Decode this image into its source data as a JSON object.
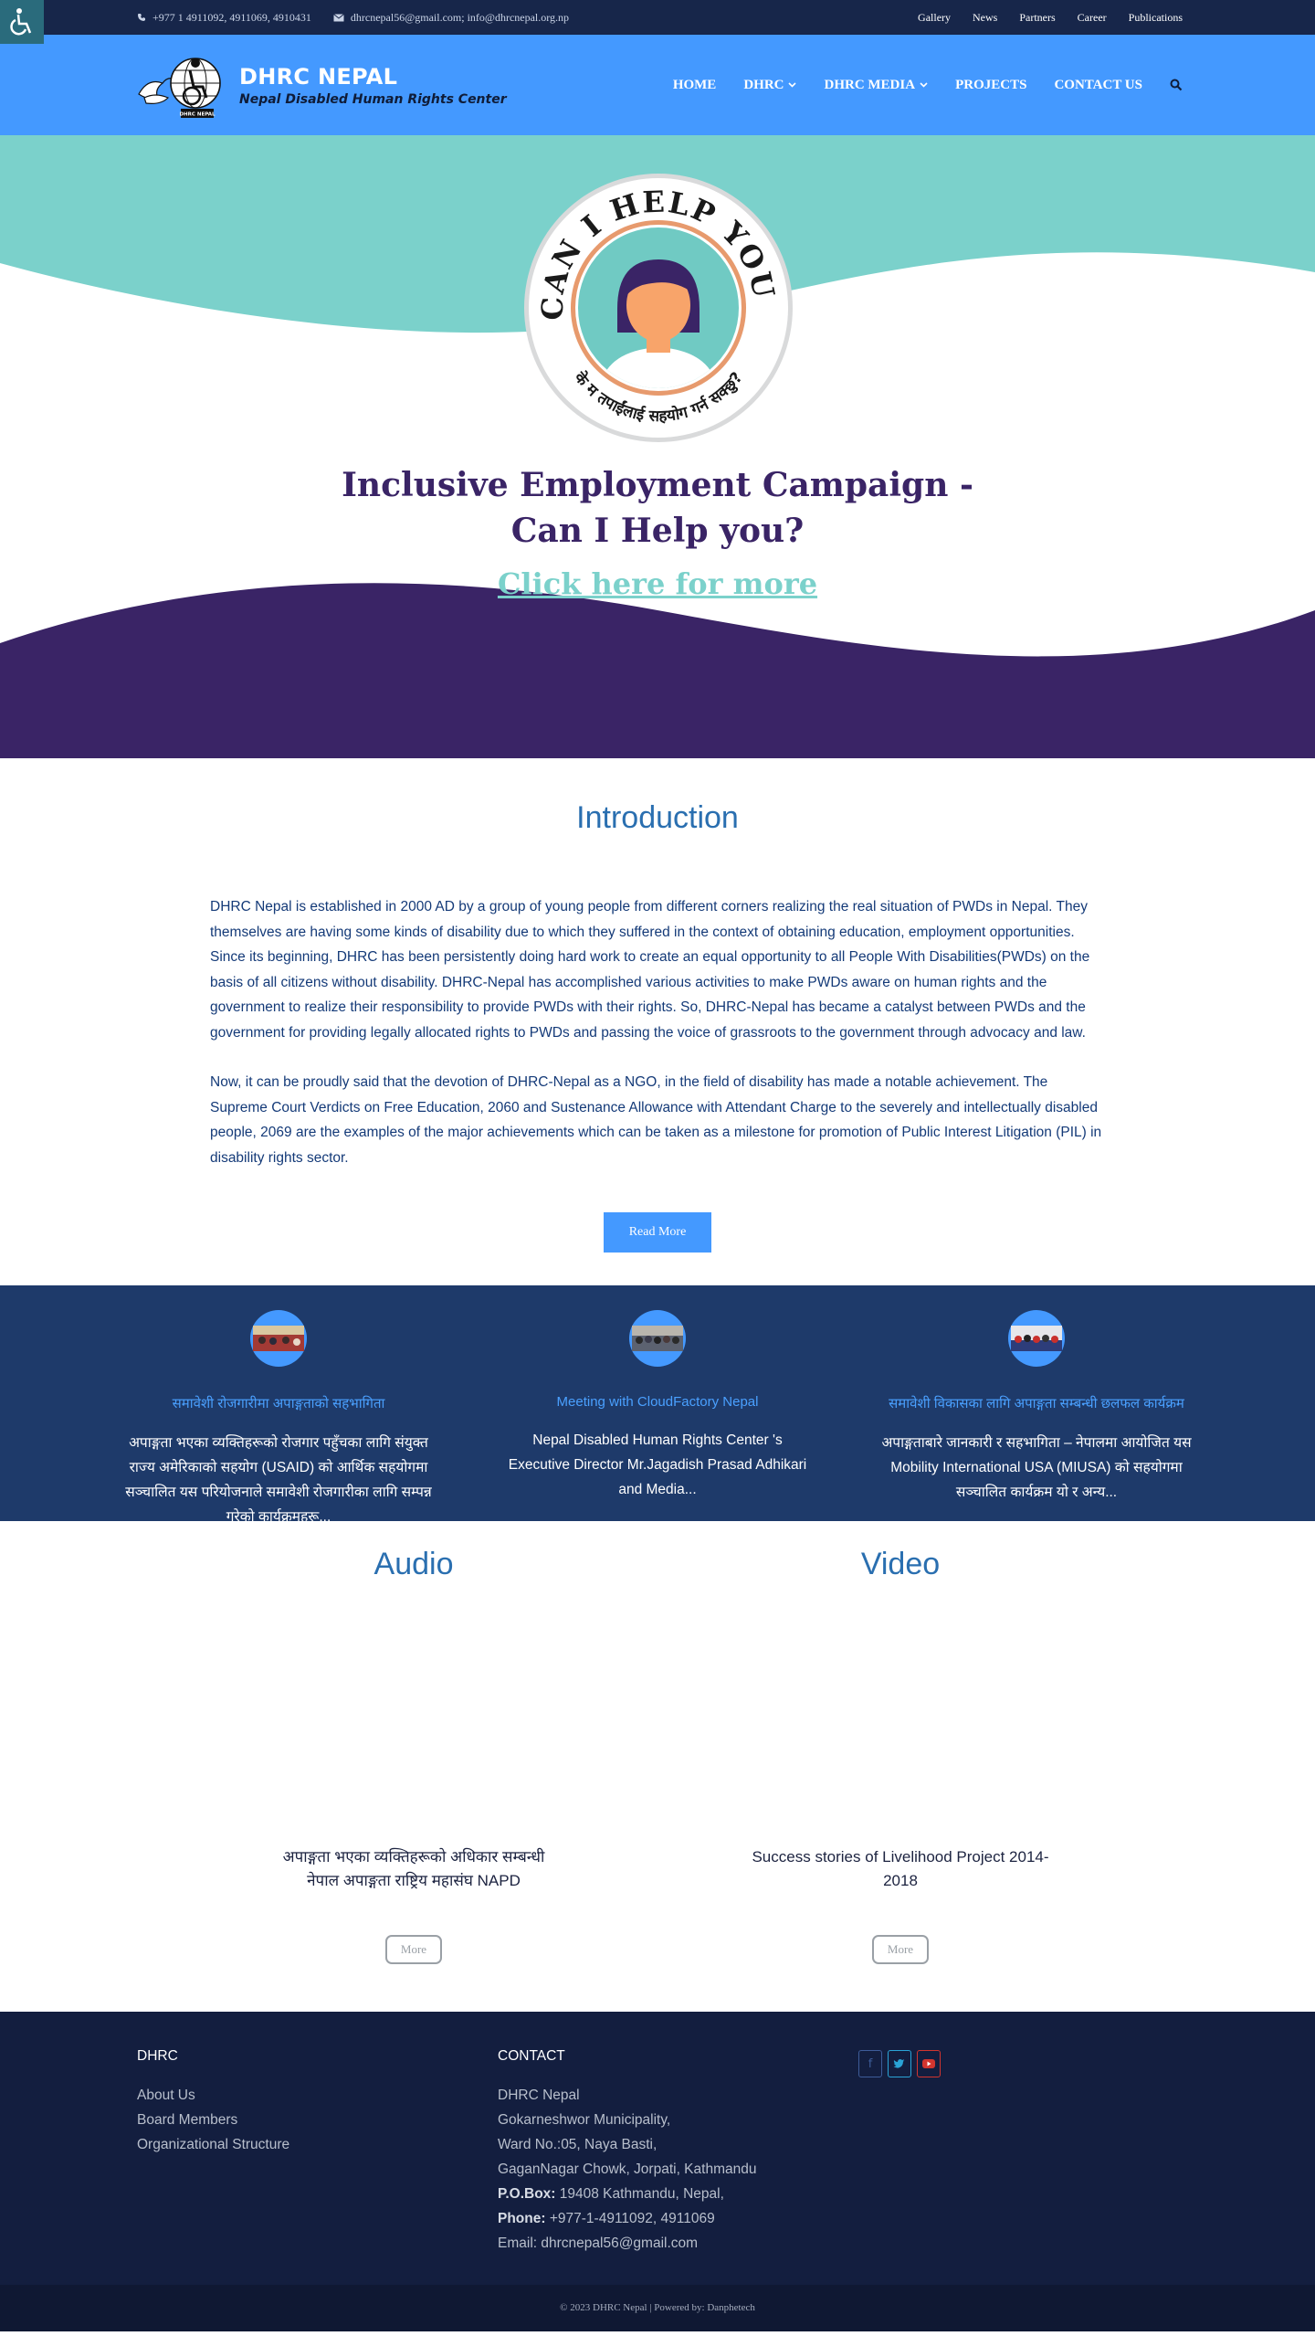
{
  "topbar": {
    "phone": "+977 1 4911092, 4911069, 4910431",
    "email": "dhrcnepal56@gmail.com; info@dhrcnepal.org.np",
    "links": [
      "Gallery",
      "News",
      "Partners",
      "Career",
      "Publications"
    ]
  },
  "header": {
    "brand_title": "DHRC NEPAL",
    "brand_subtitle": "Nepal Disabled Human Rights Center",
    "logo_caption": "DHRC NEPAL",
    "nav": [
      "HOME",
      "DHRC",
      "DHRC MEDIA",
      "PROJECTS",
      "CONTACT US"
    ]
  },
  "hero": {
    "badge_top_text": "CAN I HELP YOU?",
    "badge_bottom_text": "के म तपाईंलाई सहयोग गर्न सक्छु?",
    "headline_line1": "Inclusive Employment Campaign -",
    "headline_line2": "Can I Help you?",
    "cta": "Click here for more",
    "colors": {
      "teal": "#7bd1cb",
      "purple": "#3a2466"
    }
  },
  "intro": {
    "title": "Introduction",
    "paragraph1": "DHRC Nepal is established in 2000 AD by a group of young people from different corners realizing the real situation of PWDs in Nepal. They themselves are having some kinds of disability due to which they suffered in the context of obtaining education, employment opportunities. Since its beginning, DHRC has been persistently doing hard work to create an equal opportunity to all People With Disabilities(PWDs) on the basis of all citizens without disability. DHRC-Nepal has accomplished various activities to make PWDs aware on human rights and the government to realize their responsibility to provide PWDs with their rights. So, DHRC-Nepal has became a catalyst between PWDs and the government for providing legally allocated rights to PWDs and passing the voice of grassroots to the government through advocacy and law.",
    "paragraph2": "Now, it can be proudly said that the devotion of DHRC-Nepal as a NGO, in the field of disability has made a notable achievement. The Supreme Court Verdicts on Free Education, 2060 and Sustenance Allowance with Attendant Charge to the severely and intellectually disabled people, 2069 are the examples of the major achievements which can be taken as a milestone for promotion of Public Interest Litigation (PIL) in disability rights sector.",
    "read_more": "Read More"
  },
  "news": [
    {
      "title": "समावेशी रोजगारीमा अपाङ्गताको सहभागिता",
      "desc": "अपाङ्गता भएका व्यक्तिहरूको रोजगार पहुँचका लागि संयुक्त राज्य अमेरिकाको सहयोग (USAID) को आर्थिक सहयोगमा सञ्चालित यस परियोजनाले समावेशी रोजगारीका लागि सम्पन्न गरेको कार्यक्रमहरू..."
    },
    {
      "title": "Meeting with CloudFactory Nepal",
      "desc": "Nepal Disabled Human Rights Center 's Executive Director Mr.Jagadish Prasad Adhikari and Media..."
    },
    {
      "title": "समावेशी विकासका लागि अपाङ्गता सम्बन्धी छलफल कार्यक्रम",
      "desc": "अपाङ्गताबारे जानकारी र सहभागिता – नेपालमा आयोजित यस Mobility International USA (MIUSA) को सहयोगमा सञ्चालित कार्यक्रम यो र अन्य..."
    }
  ],
  "media": {
    "audio_title": "Audio",
    "audio_caption": "अपाङ्गता भएका व्यक्तिहरूको अधिकार सम्बन्धी नेपाल अपाङ्गता राष्ट्रिय महासंघ NAPD",
    "video_title": "Video",
    "video_caption": "Success stories of Livelihood Project 2014-2018",
    "more_label": "More"
  },
  "footer": {
    "dhrc_heading": "DHRC",
    "dhrc_links": [
      "About Us",
      "Board Members",
      "Organizational Structure"
    ],
    "contact_heading": "CONTACT",
    "org": "DHRC Nepal",
    "addr1": "Gokarneshwor Municipality,",
    "addr2": "Ward No.:05, Naya Basti,",
    "addr3": "GaganNagar Chowk, Jorpati, Kathmandu",
    "pobox_label": "P.O.Box:",
    "pobox_value": "19408 Kathmandu, Nepal,",
    "phone_label": "Phone:",
    "phone_value": "+977-1-4911092, 4911069",
    "email_line": "Email: dhrcnepal56@gmail.com",
    "social_icons": [
      "facebook-icon",
      "twitter-icon",
      "youtube-icon"
    ]
  },
  "copyright": "© 2023 DHRC Nepal | Powered by: Danphetech"
}
